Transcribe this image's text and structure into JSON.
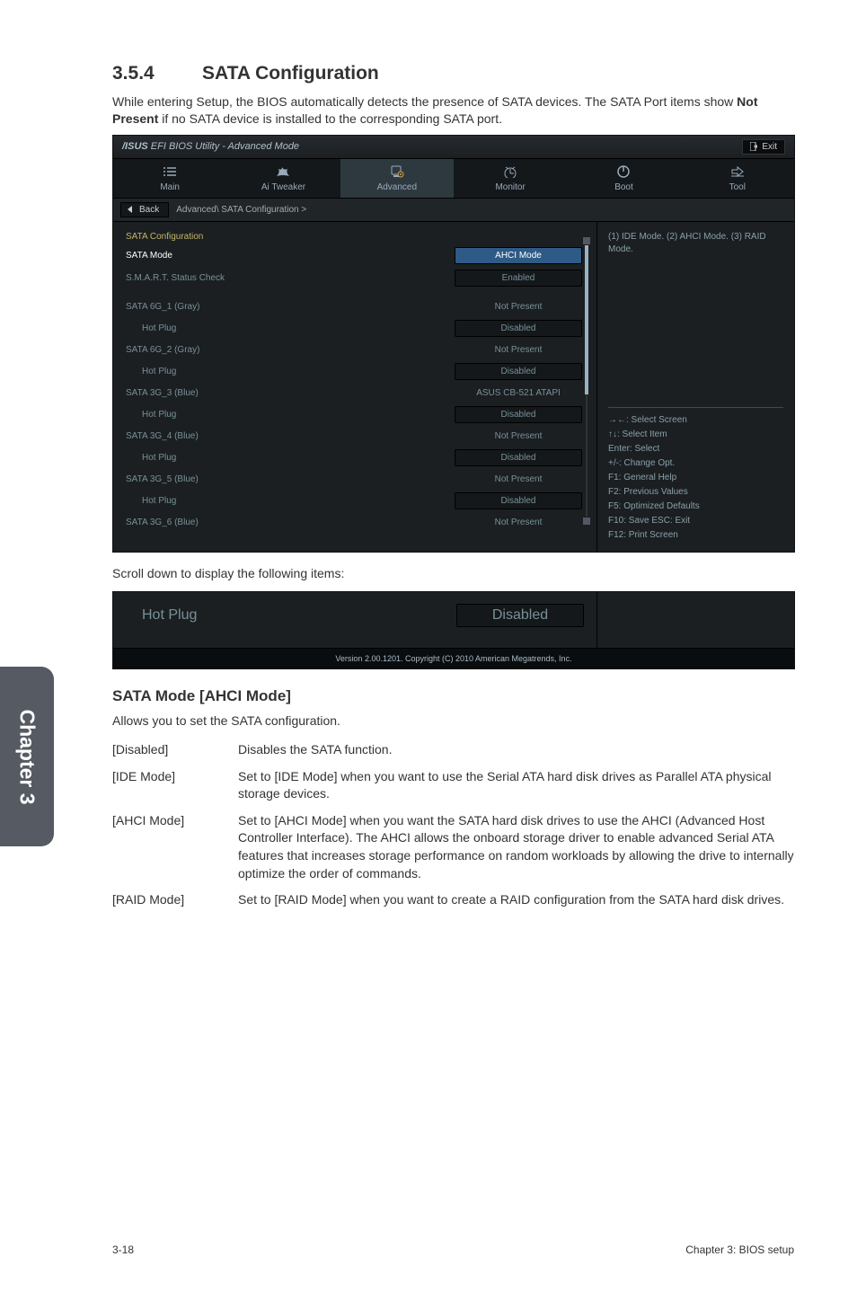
{
  "section_number": "3.5.4",
  "section_title": "SATA Configuration",
  "intro_html": "While entering Setup, the BIOS automatically detects the presence of SATA devices. The SATA Port items show <b>Not Present</b> if no SATA device is installed to the corresponding SATA port.",
  "bios": {
    "logo_prefix": "/ISUS",
    "logo_text": "  EFI BIOS Utility - Advanced Mode",
    "exit": "Exit",
    "tabs": [
      "Main",
      "Ai Tweaker",
      "Advanced",
      "Monitor",
      "Boot",
      "Tool"
    ],
    "active_tab": 2,
    "back": "Back",
    "breadcrumb": "Advanced\\ SATA Configuration  >",
    "info_text": "(1) IDE Mode. (2) AHCI Mode. (3) RAID Mode.",
    "help": [
      "→←: Select Screen",
      "↑↓: Select Item",
      "Enter: Select",
      "+/-: Change Opt.",
      "F1: General Help",
      "F2: Previous Values",
      "F5: Optimized Defaults",
      "F10: Save   ESC: Exit",
      "F12: Print Screen"
    ],
    "rows": [
      {
        "label": "SATA Configuration",
        "value": null,
        "type": "heading",
        "indent": false
      },
      {
        "label": "SATA Mode",
        "value": "AHCI Mode",
        "type": "pill",
        "indent": false,
        "selected": true
      },
      {
        "label": "S.M.A.R.T. Status Check",
        "value": "Enabled",
        "type": "pill",
        "indent": false
      },
      {
        "label": "",
        "value": null,
        "type": "blank",
        "indent": false
      },
      {
        "label": "SATA 6G_1 (Gray)",
        "value": "Not Present",
        "type": "text",
        "indent": false
      },
      {
        "label": "Hot Plug",
        "value": "Disabled",
        "type": "pill",
        "indent": true
      },
      {
        "label": "SATA 6G_2 (Gray)",
        "value": "Not Present",
        "type": "text",
        "indent": false
      },
      {
        "label": "Hot Plug",
        "value": "Disabled",
        "type": "pill",
        "indent": true
      },
      {
        "label": "SATA 3G_3 (Blue)",
        "value": "ASUS   CB-521 ATAPI",
        "type": "text",
        "indent": false
      },
      {
        "label": "Hot Plug",
        "value": "Disabled",
        "type": "pill",
        "indent": true
      },
      {
        "label": "SATA 3G_4 (Blue)",
        "value": "Not Present",
        "type": "text",
        "indent": false
      },
      {
        "label": "Hot Plug",
        "value": "Disabled",
        "type": "pill",
        "indent": true
      },
      {
        "label": "SATA 3G_5 (Blue)",
        "value": "Not Present",
        "type": "text",
        "indent": false
      },
      {
        "label": "Hot Plug",
        "value": "Disabled",
        "type": "pill",
        "indent": true
      },
      {
        "label": "SATA 3G_6 (Blue)",
        "value": "Not Present",
        "type": "text",
        "indent": false
      }
    ]
  },
  "scroll_note": "Scroll down to display the following items:",
  "snippet_row": {
    "label": "Hot Plug",
    "value": "Disabled"
  },
  "version_line": "Version 2.00.1201.  Copyright (C) 2010 American Megatrends, Inc.",
  "subsection_title": "SATA Mode [AHCI Mode]",
  "subsection_desc": "Allows you to set the SATA configuration.",
  "defs": [
    {
      "key": "[Disabled]",
      "val": "Disables the SATA function."
    },
    {
      "key": "[IDE Mode]",
      "val": "Set to [IDE Mode] when you want to use the Serial ATA hard disk drives as Parallel ATA physical storage devices."
    },
    {
      "key": "[AHCI Mode]",
      "val": "Set to [AHCI Mode] when you want the SATA hard disk drives to use the AHCI (Advanced Host Controller Interface). The AHCI allows the onboard storage driver to enable advanced Serial ATA features that increases storage performance on random workloads by allowing the drive to internally optimize the order of commands."
    },
    {
      "key": "[RAID Mode]",
      "val": "Set to [RAID Mode] when you want to create a RAID configuration from the SATA hard disk drives."
    }
  ],
  "side_tab": "Chapter 3",
  "footer_left": "3-18",
  "footer_right": "Chapter 3: BIOS setup"
}
